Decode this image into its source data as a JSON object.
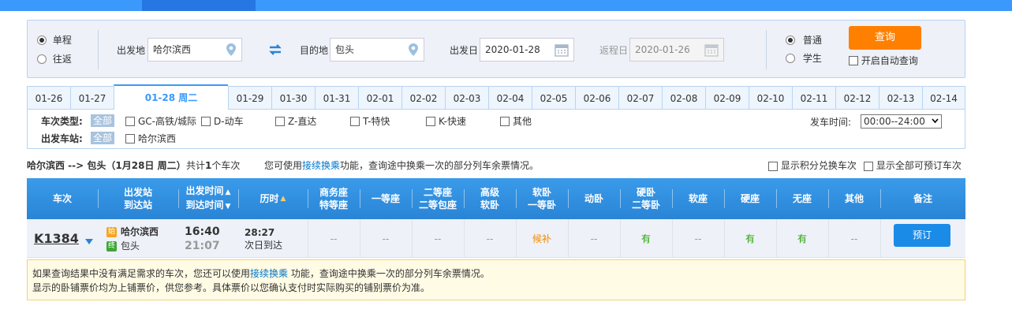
{
  "colors": {
    "accent": "#3b99fc",
    "query_button": "#ff8000",
    "available": "#26a306",
    "waitlist": "#f18a00",
    "book_button": "#1b8be8"
  },
  "trip_type": {
    "one_way": "单程",
    "round_trip": "往返",
    "selected": "one_way"
  },
  "from": {
    "label": "出发地",
    "value": "哈尔滨西"
  },
  "to": {
    "label": "目的地",
    "value": "包头"
  },
  "depart_date": {
    "label": "出发日",
    "value": "2020-01-28"
  },
  "return_date": {
    "label": "返程日",
    "value": "2020-01-26"
  },
  "passenger_type": {
    "normal": "普通",
    "student": "学生",
    "selected": "normal"
  },
  "query_button": "查询",
  "auto_query": "开启自动查询",
  "date_tabs": [
    "01-26",
    "01-27",
    "01-28 周二",
    "01-29",
    "01-30",
    "01-31",
    "02-01",
    "02-02",
    "02-03",
    "02-04",
    "02-05",
    "02-06",
    "02-07",
    "02-08",
    "02-09",
    "02-10",
    "02-11",
    "02-12",
    "02-13",
    "02-14"
  ],
  "active_date_index": 2,
  "filters": {
    "train_type_label": "车次类型:",
    "all_label": "全部",
    "train_types": [
      "GC-高铁/城际",
      "D-动车",
      "Z-直达",
      "T-特快",
      "K-快速",
      "其他"
    ],
    "station_label": "出发车站:",
    "stations": [
      "哈尔滨西"
    ],
    "depart_time_label": "发车时间:",
    "depart_time_value": "00:00--24:00"
  },
  "summary": {
    "route": "哈尔滨西 --> 包头（1月28日  周二）",
    "count_prefix": "共计",
    "count": "1",
    "count_suffix": "个车次",
    "hint_prefix": "您可使用",
    "hint_link": "接续换乘",
    "hint_suffix": "功能，查询途中换乘一次的部分列车余票情况。",
    "opt_points": "显示积分兑换车次",
    "opt_bookable": "显示全部可预订车次"
  },
  "table_headers": {
    "train": "车次",
    "stations_1": "出发站",
    "stations_2": "到达站",
    "times_1": "出发时间",
    "times_2": "到达时间",
    "duration": "历时",
    "business_1": "商务座",
    "business_2": "特等座",
    "first": "一等座",
    "second_1": "二等座",
    "second_2": "二等包座",
    "premium_1": "高级",
    "premium_2": "软卧",
    "soft_sleeper_1": "软卧",
    "soft_sleeper_2": "一等卧",
    "moving_sleeper": "动卧",
    "hard_sleeper_1": "硬卧",
    "hard_sleeper_2": "二等卧",
    "soft_seat": "软座",
    "hard_seat": "硬座",
    "no_seat": "无座",
    "other": "其他",
    "remark": "备注"
  },
  "train": {
    "number": "K1384",
    "from_badge": "始",
    "from_station": "哈尔滨西",
    "to_badge": "终",
    "to_station": "包头",
    "depart_time": "16:40",
    "arrive_time": "21:07",
    "duration": "28:27",
    "arrival_day": "次日到达",
    "business": "--",
    "first": "--",
    "second": "--",
    "premium_sleeper": "--",
    "soft_sleeper": "候补",
    "moving_sleeper": "--",
    "hard_sleeper": "有",
    "soft_seat": "--",
    "hard_seat": "有",
    "no_seat": "有",
    "other": "--",
    "book": "预订"
  },
  "notice": {
    "line1_prefix": "如果查询结果中没有满足需求的车次，您还可以使用",
    "line1_link": "接续换乘",
    "line1_suffix": " 功能，查询途中换乘一次的部分列车余票情况。",
    "line2": "显示的卧铺票价均为上铺票价，供您参考。具体票价以您确认支付时实际购买的铺别票价为准。"
  }
}
